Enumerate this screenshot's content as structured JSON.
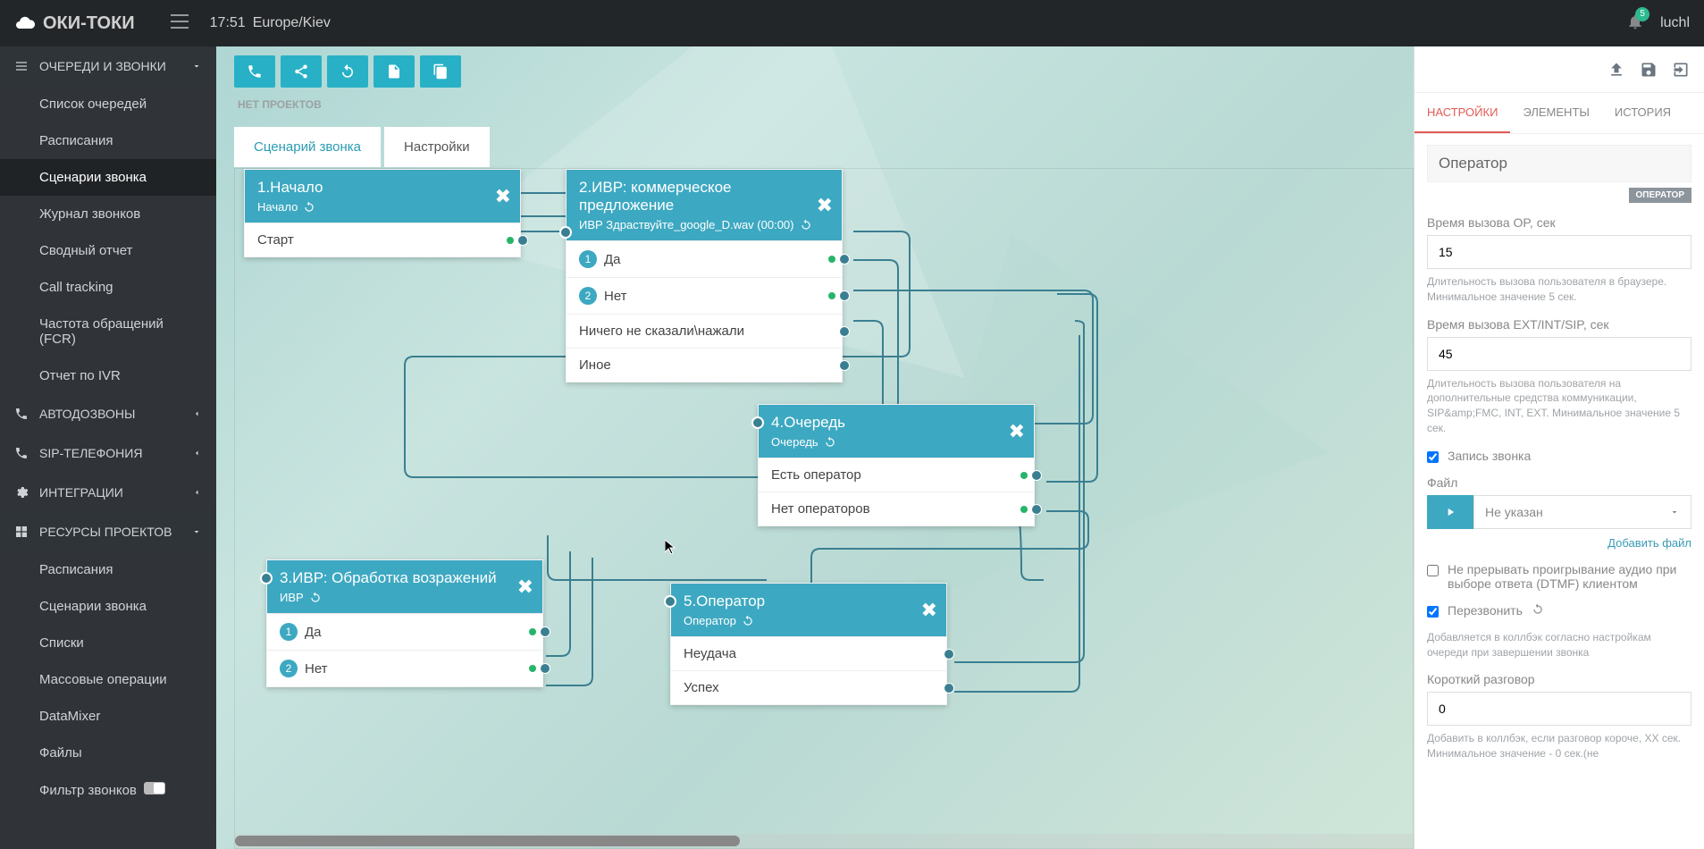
{
  "topbar": {
    "brand": "ОКИ-ТОКИ",
    "time": "17:51",
    "tz": "Europe/Kiev",
    "notifications": "5",
    "user": "luchl"
  },
  "sidebar": {
    "section_queues": "ОЧЕРЕДИ И ЗВОНКИ",
    "items_queues": [
      "Список очередей",
      "Расписания",
      "Сценарии звонка",
      "Журнал звонков",
      "Сводный отчет",
      "Call tracking",
      "Частота обращений (FCR)",
      "Отчет по IVR"
    ],
    "section_autodial": "АВТОДОЗВОНЫ",
    "section_sip": "SIP-ТЕЛЕФОНИЯ",
    "section_integrations": "ИНТЕГРАЦИИ",
    "section_resources": "РЕСУРСЫ ПРОЕКТОВ",
    "items_resources": [
      "Расписания",
      "Сценарии звонка",
      "Списки",
      "Массовые операции",
      "DataMixer",
      "Файлы",
      "Фильтр звонков"
    ]
  },
  "canvas": {
    "no_projects": "НЕТ ПРОЕКТОВ",
    "tab1": "Сценарий звонка",
    "tab2": "Настройки",
    "node1": {
      "title": "1.Начало",
      "sub": "Начало",
      "row": "Старт"
    },
    "node2": {
      "title": "2.ИВР: коммерческое предложение",
      "sub": "ИВР Здраствуйте_google_D.wav (00:00)",
      "r1": "Да",
      "r2": "Нет",
      "r3": "Ничего не сказали\\нажали",
      "r4": "Иное"
    },
    "node3": {
      "title": "3.ИВР: Обработка возражений",
      "sub": "ИВР",
      "r1": "Да",
      "r2": "Нет"
    },
    "node4": {
      "title": "4.Очередь",
      "sub": "Очередь",
      "r1": "Есть оператор",
      "r2": "Нет операторов"
    },
    "node5": {
      "title": "5.Оператор",
      "sub": "Оператор",
      "r1": "Неудача",
      "r2": "Успех"
    }
  },
  "panel": {
    "tab1": "НАСТРОЙКИ",
    "tab2": "ЭЛЕМЕНТЫ",
    "tab3": "ИСТОРИЯ",
    "title": "Оператор",
    "badge": "ОПЕРАТОР",
    "f1_label": "Время вызова OP, сек",
    "f1_value": "15",
    "f1_help": "Длительность вызова пользователя в браузере. Минимальное значение 5 сек.",
    "f2_label": "Время вызова EXT/INT/SIP, сек",
    "f2_value": "45",
    "f2_help": "Длительность вызова пользователя на дополнительные средства коммуникации, SIP&amp;FMC, INT, EXT. Минимальное значение 5 сек.",
    "chk_record": "Запись звонка",
    "file_label": "Файл",
    "file_select": "Не указан",
    "file_add": "Добавить файл",
    "chk_dtmf": "Не прерывать проигрывание аудио при выборе ответа (DTMF) клиентом",
    "chk_callback": "Перезвонить",
    "callback_help": "Добавляется в коллбэк согласно настройкам очереди при завершении звонка",
    "f3_label": "Короткий разговор",
    "f3_value": "0",
    "f3_help": "Добавить в коллбэк, если разговор короче, XX сек. Минимальное значение - 0 сек.(не"
  }
}
